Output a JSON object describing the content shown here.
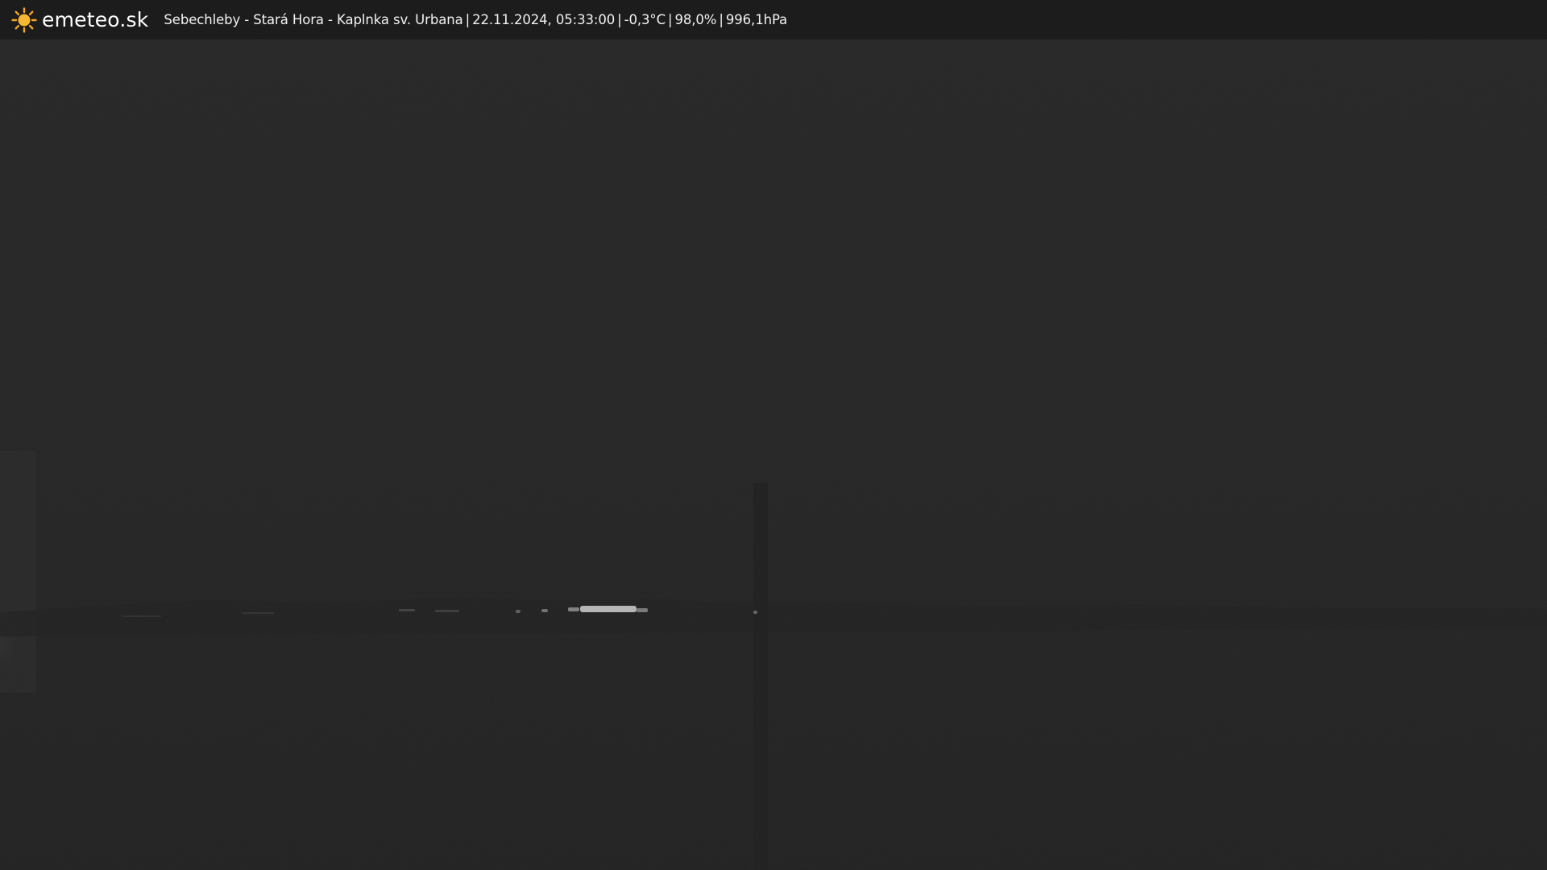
{
  "logo": {
    "brand": "emeteo.sk",
    "icon": "sun-icon",
    "icon_color": "#f5a623"
  },
  "caption": {
    "location": "Sebechleby - Stará Hora - Kaplnka sv. Urbana",
    "datetime": "22.11.2024, 05:33:00",
    "temperature": "-0,3°C",
    "humidity": "98,0%",
    "pressure": "996,1hPa",
    "separator": "|"
  },
  "colors": {
    "bar_background": "#1c1c1c",
    "scene_background": "#232323",
    "lights": "#cfcfcf"
  }
}
